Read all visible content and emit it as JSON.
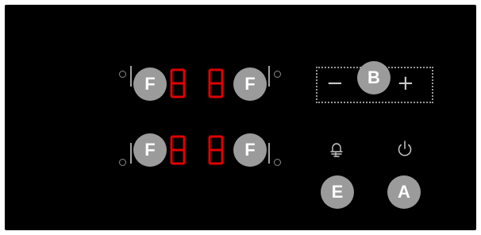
{
  "badges": {
    "a": "A",
    "b": "B",
    "e": "E",
    "f": "F"
  },
  "controls": {
    "minus": "−",
    "plus": "+"
  },
  "icons": {
    "power": "power-icon",
    "bell": "bell-icon"
  },
  "digits": {
    "display": "8"
  },
  "colors": {
    "panel": "#000000",
    "digit": "#e00000",
    "badge": "#9b9b9b",
    "badge_text": "#ffffff",
    "outline": "#9a9a9a"
  }
}
